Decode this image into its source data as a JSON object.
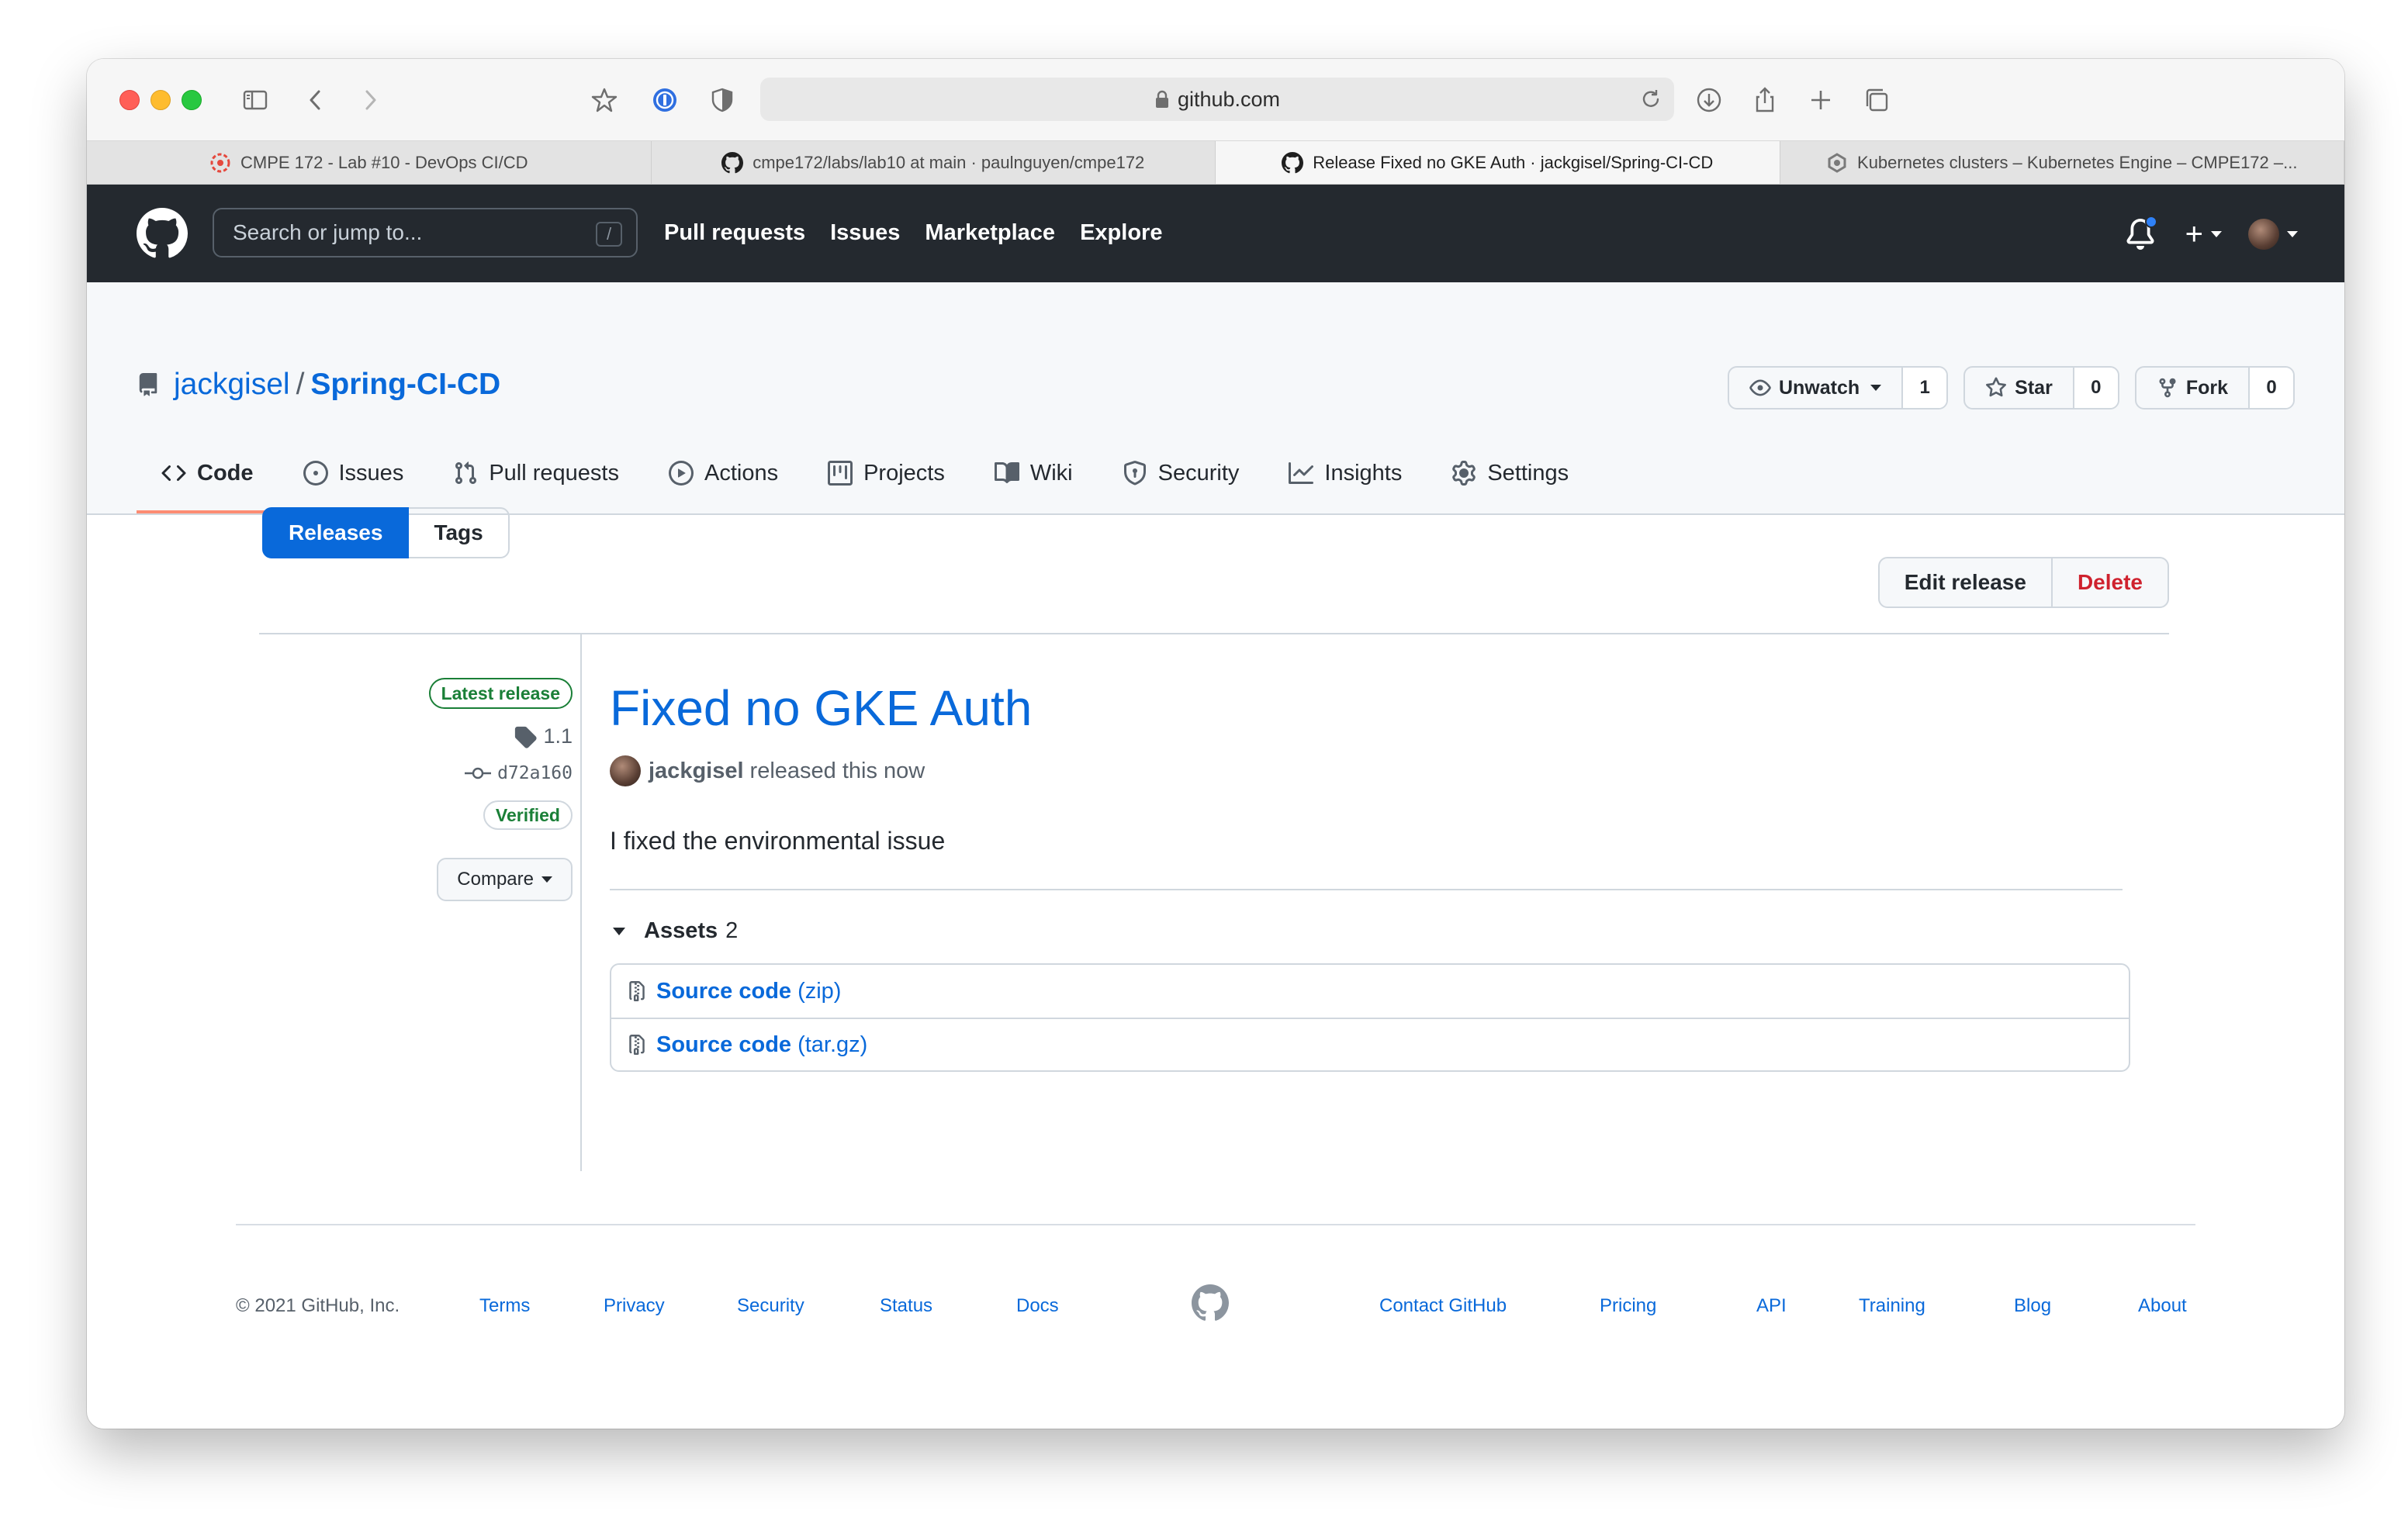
{
  "browser": {
    "url": "github.com",
    "tabs": [
      {
        "label": "CMPE 172 - Lab #10 - DevOps CI/CD",
        "icon": "atlassian-icon",
        "active": false
      },
      {
        "label": "cmpe172/labs/lab10 at main · paulnguyen/cmpe172",
        "icon": "github-icon",
        "active": false
      },
      {
        "label": "Release Fixed no GKE Auth · jackgisel/Spring-CI-CD",
        "icon": "github-icon",
        "active": true
      },
      {
        "label": "Kubernetes clusters – Kubernetes Engine – CMPE172 –...",
        "icon": "gcp-icon",
        "active": false
      }
    ]
  },
  "header": {
    "search_placeholder": "Search or jump to...",
    "search_hint": "/",
    "nav": [
      "Pull requests",
      "Issues",
      "Marketplace",
      "Explore"
    ],
    "plus": "+"
  },
  "repo": {
    "owner": "jackgisel",
    "separator": "/",
    "name": "Spring-CI-CD",
    "watch_label": "Unwatch",
    "watch_count": "1",
    "star_label": "Star",
    "star_count": "0",
    "fork_label": "Fork",
    "fork_count": "0",
    "tabs": [
      {
        "label": "Code",
        "icon": "code-icon",
        "active": true
      },
      {
        "label": "Issues",
        "icon": "issue-icon",
        "active": false
      },
      {
        "label": "Pull requests",
        "icon": "pull-request-icon",
        "active": false
      },
      {
        "label": "Actions",
        "icon": "play-icon",
        "active": false
      },
      {
        "label": "Projects",
        "icon": "project-icon",
        "active": false
      },
      {
        "label": "Wiki",
        "icon": "book-icon",
        "active": false
      },
      {
        "label": "Security",
        "icon": "shield-icon",
        "active": false
      },
      {
        "label": "Insights",
        "icon": "graph-icon",
        "active": false
      },
      {
        "label": "Settings",
        "icon": "gear-icon",
        "active": false
      }
    ]
  },
  "subnav": {
    "releases": "Releases",
    "tags": "Tags"
  },
  "actions": {
    "edit": "Edit release",
    "delete": "Delete"
  },
  "release": {
    "latest_badge": "Latest release",
    "tag": "1.1",
    "commit": "d72a160",
    "verified": "Verified",
    "compare": "Compare",
    "title": "Fixed no GKE Auth",
    "author": "jackgisel",
    "released_text": "released this now",
    "body": "I fixed the environmental issue",
    "assets_label": "Assets",
    "assets_count": "2",
    "assets": [
      {
        "name": "Source code",
        "ext": "(zip)"
      },
      {
        "name": "Source code",
        "ext": "(tar.gz)"
      }
    ]
  },
  "footer": {
    "copyright": "© 2021 GitHub, Inc.",
    "links_left": [
      "Terms",
      "Privacy",
      "Security",
      "Status",
      "Docs"
    ],
    "links_right": [
      "Contact GitHub",
      "Pricing",
      "API",
      "Training",
      "Blog",
      "About"
    ]
  },
  "colors": {
    "header_bg": "#24292f",
    "link": "#0969da",
    "primary_button": "#0969da",
    "danger": "#cf222e",
    "success": "#1a7f37",
    "active_tab_underline": "#fd8c73"
  }
}
